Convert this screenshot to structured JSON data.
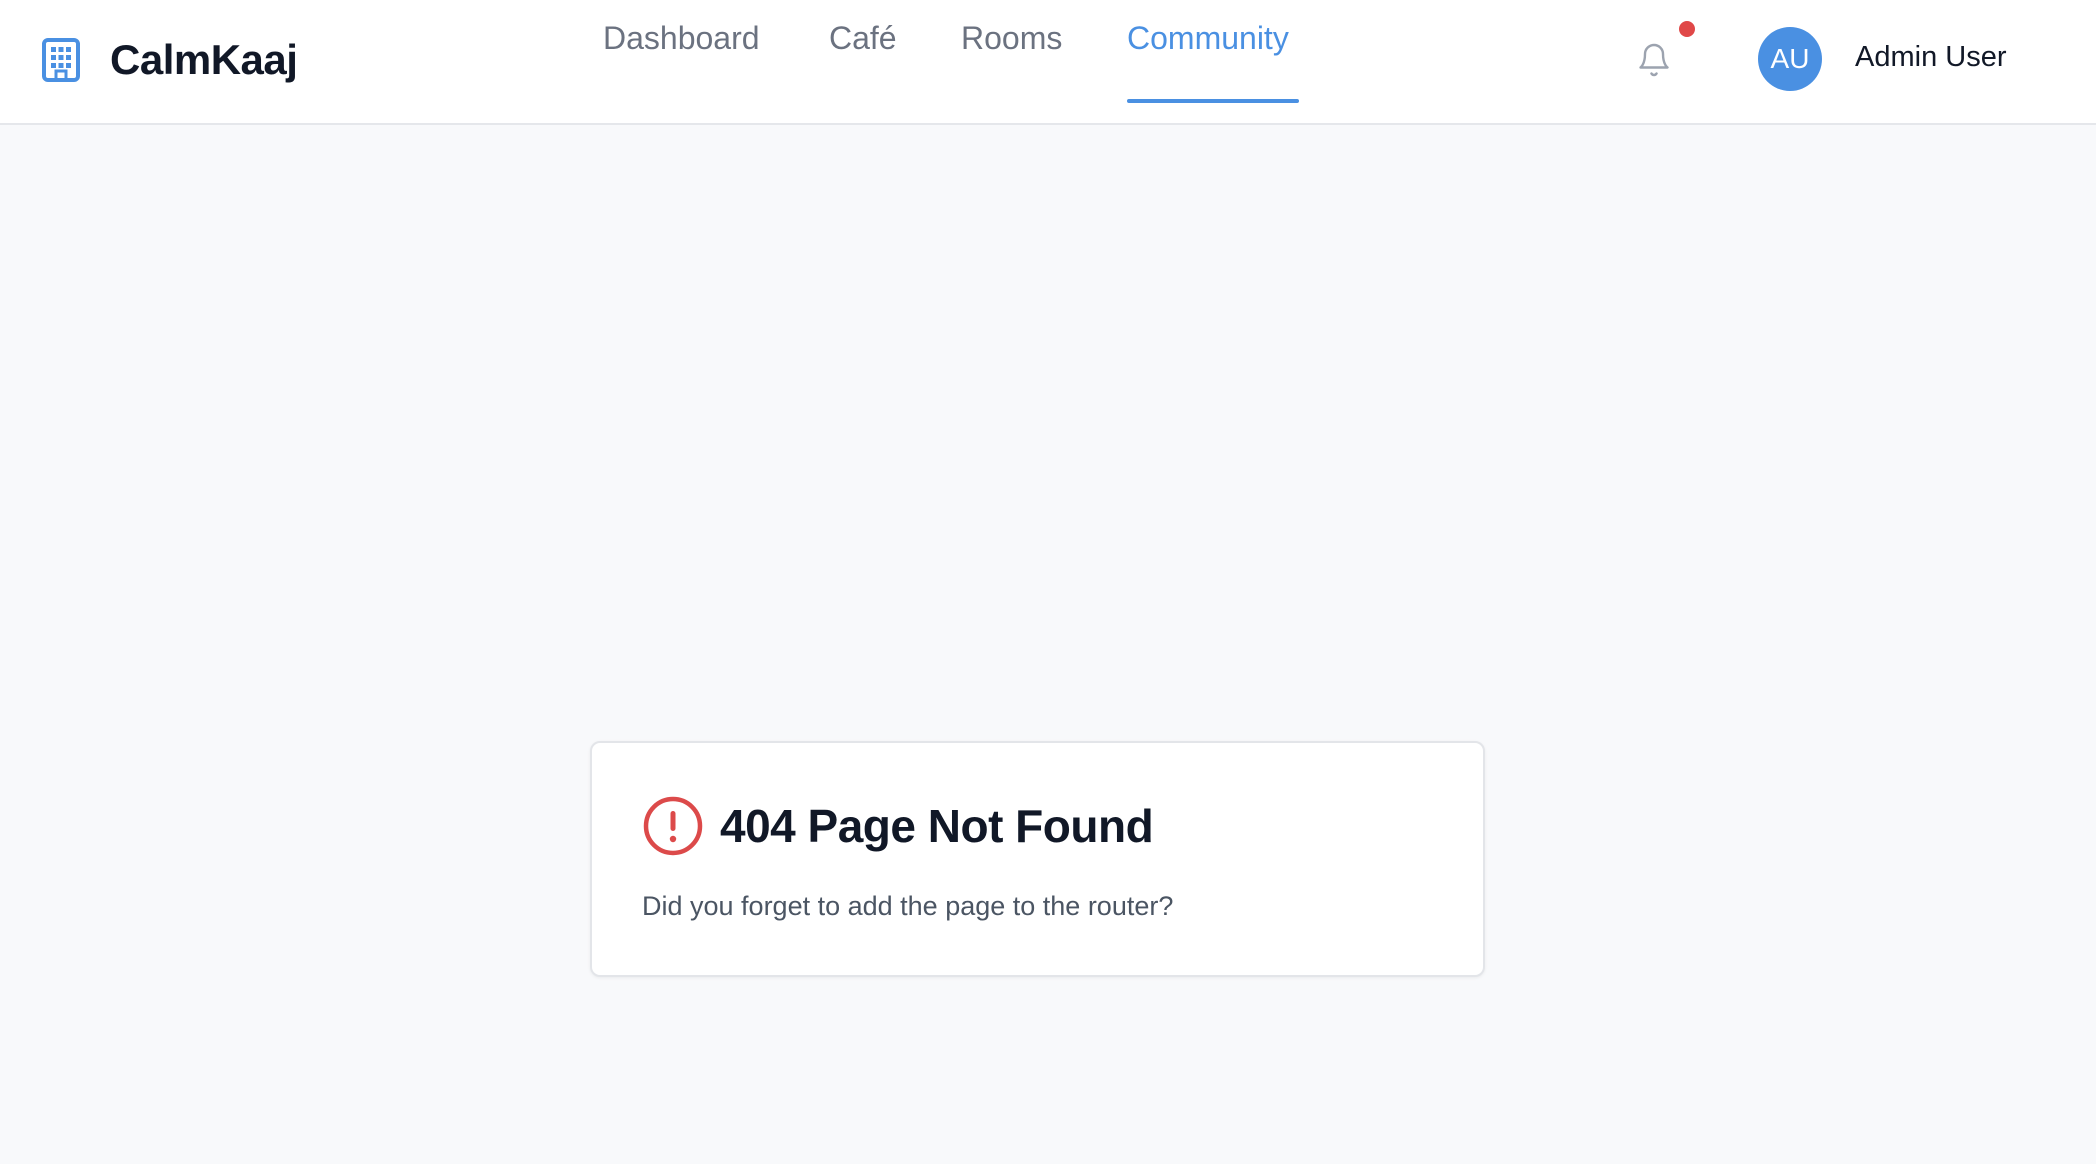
{
  "brand": {
    "name": "CalmKaaj",
    "icon": "building-icon"
  },
  "nav": {
    "tabs": [
      {
        "label": "Dashboard",
        "active": false
      },
      {
        "label": "Café",
        "active": false
      },
      {
        "label": "Rooms",
        "active": false
      },
      {
        "label": "Community",
        "active": true
      }
    ]
  },
  "header": {
    "notification_icon": "bell-icon",
    "has_unread_notifications": true,
    "user": {
      "initials": "AU",
      "name": "Admin User"
    }
  },
  "error_card": {
    "icon": "alert-circle-icon",
    "title": "404 Page Not Found",
    "message": "Did you forget to add the page to the router?"
  },
  "colors": {
    "accent": "#4a90e2",
    "error": "#dc4a4a",
    "notification_dot": "#e04848",
    "background": "#f8f9fb"
  }
}
